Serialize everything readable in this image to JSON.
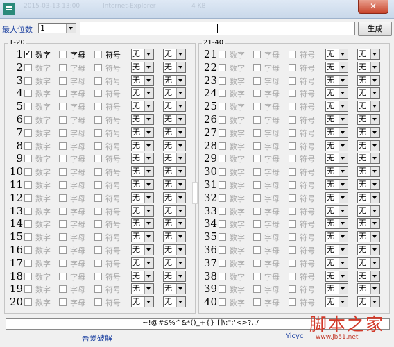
{
  "window": {
    "ghost_texts": [
      "2015-03-13 13:00",
      "Internet-Explorer",
      "4 KB"
    ],
    "close_label": "✕"
  },
  "toolbar": {
    "max_digits_label": "最大位数",
    "max_digits_value": "1",
    "output_value": "",
    "generate_label": "生成"
  },
  "left_group": {
    "title": "1-20",
    "rows": [
      {
        "n": "1",
        "digit": "数字",
        "letter": "字母",
        "symbol": "符号",
        "opt1": "无",
        "opt2": "无"
      },
      {
        "n": "2",
        "digit": "数字",
        "letter": "字母",
        "symbol": "符号",
        "opt1": "无",
        "opt2": "无"
      },
      {
        "n": "3",
        "digit": "数字",
        "letter": "字母",
        "symbol": "符号",
        "opt1": "无",
        "opt2": "无"
      },
      {
        "n": "4",
        "digit": "数字",
        "letter": "字母",
        "symbol": "符号",
        "opt1": "无",
        "opt2": "无"
      },
      {
        "n": "5",
        "digit": "数字",
        "letter": "字母",
        "symbol": "符号",
        "opt1": "无",
        "opt2": "无"
      },
      {
        "n": "6",
        "digit": "数字",
        "letter": "字母",
        "symbol": "符号",
        "opt1": "无",
        "opt2": "无"
      },
      {
        "n": "7",
        "digit": "数字",
        "letter": "字母",
        "symbol": "符号",
        "opt1": "无",
        "opt2": "无"
      },
      {
        "n": "8",
        "digit": "数字",
        "letter": "字母",
        "symbol": "符号",
        "opt1": "无",
        "opt2": "无"
      },
      {
        "n": "9",
        "digit": "数字",
        "letter": "字母",
        "symbol": "符号",
        "opt1": "无",
        "opt2": "无"
      },
      {
        "n": "10",
        "digit": "数字",
        "letter": "字母",
        "symbol": "符号",
        "opt1": "无",
        "opt2": "无"
      },
      {
        "n": "11",
        "digit": "数字",
        "letter": "字母",
        "symbol": "符号",
        "opt1": "无",
        "opt2": "无"
      },
      {
        "n": "12",
        "digit": "数字",
        "letter": "字母",
        "symbol": "符号",
        "opt1": "无",
        "opt2": "无"
      },
      {
        "n": "13",
        "digit": "数字",
        "letter": "字母",
        "symbol": "符号",
        "opt1": "无",
        "opt2": "无"
      },
      {
        "n": "14",
        "digit": "数字",
        "letter": "字母",
        "symbol": "符号",
        "opt1": "无",
        "opt2": "无"
      },
      {
        "n": "15",
        "digit": "数字",
        "letter": "字母",
        "symbol": "符号",
        "opt1": "无",
        "opt2": "无"
      },
      {
        "n": "16",
        "digit": "数字",
        "letter": "字母",
        "symbol": "符号",
        "opt1": "无",
        "opt2": "无"
      },
      {
        "n": "17",
        "digit": "数字",
        "letter": "字母",
        "symbol": "符号",
        "opt1": "无",
        "opt2": "无"
      },
      {
        "n": "18",
        "digit": "数字",
        "letter": "字母",
        "symbol": "符号",
        "opt1": "无",
        "opt2": "无"
      },
      {
        "n": "19",
        "digit": "数字",
        "letter": "字母",
        "symbol": "符号",
        "opt1": "无",
        "opt2": "无"
      },
      {
        "n": "20",
        "digit": "数字",
        "letter": "字母",
        "symbol": "符号",
        "opt1": "无",
        "opt2": "无"
      }
    ],
    "enabled_rows": 1
  },
  "right_group": {
    "title": "21-40",
    "rows": [
      {
        "n": "21",
        "digit": "数字",
        "letter": "字母",
        "symbol": "符号",
        "opt1": "无",
        "opt2": "无"
      },
      {
        "n": "22",
        "digit": "数字",
        "letter": "字母",
        "symbol": "符号",
        "opt1": "无",
        "opt2": "无"
      },
      {
        "n": "23",
        "digit": "数字",
        "letter": "字母",
        "symbol": "符号",
        "opt1": "无",
        "opt2": "无"
      },
      {
        "n": "24",
        "digit": "数字",
        "letter": "字母",
        "symbol": "符号",
        "opt1": "无",
        "opt2": "无"
      },
      {
        "n": "25",
        "digit": "数字",
        "letter": "字母",
        "symbol": "符号",
        "opt1": "无",
        "opt2": "无"
      },
      {
        "n": "26",
        "digit": "数字",
        "letter": "字母",
        "symbol": "符号",
        "opt1": "无",
        "opt2": "无"
      },
      {
        "n": "27",
        "digit": "数字",
        "letter": "字母",
        "symbol": "符号",
        "opt1": "无",
        "opt2": "无"
      },
      {
        "n": "28",
        "digit": "数字",
        "letter": "字母",
        "symbol": "符号",
        "opt1": "无",
        "opt2": "无"
      },
      {
        "n": "29",
        "digit": "数字",
        "letter": "字母",
        "symbol": "符号",
        "opt1": "无",
        "opt2": "无"
      },
      {
        "n": "30",
        "digit": "数字",
        "letter": "字母",
        "symbol": "符号",
        "opt1": "无",
        "opt2": "无"
      },
      {
        "n": "31",
        "digit": "数字",
        "letter": "字母",
        "symbol": "符号",
        "opt1": "无",
        "opt2": "无"
      },
      {
        "n": "32",
        "digit": "数字",
        "letter": "字母",
        "symbol": "符号",
        "opt1": "无",
        "opt2": "无"
      },
      {
        "n": "33",
        "digit": "数字",
        "letter": "字母",
        "symbol": "符号",
        "opt1": "无",
        "opt2": "无"
      },
      {
        "n": "34",
        "digit": "数字",
        "letter": "字母",
        "symbol": "符号",
        "opt1": "无",
        "opt2": "无"
      },
      {
        "n": "35",
        "digit": "数字",
        "letter": "字母",
        "symbol": "符号",
        "opt1": "无",
        "opt2": "无"
      },
      {
        "n": "36",
        "digit": "数字",
        "letter": "字母",
        "symbol": "符号",
        "opt1": "无",
        "opt2": "无"
      },
      {
        "n": "37",
        "digit": "数字",
        "letter": "字母",
        "symbol": "符号",
        "opt1": "无",
        "opt2": "无"
      },
      {
        "n": "38",
        "digit": "数字",
        "letter": "字母",
        "symbol": "符号",
        "opt1": "无",
        "opt2": "无"
      },
      {
        "n": "39",
        "digit": "数字",
        "letter": "字母",
        "symbol": "符号",
        "opt1": "无",
        "opt2": "无"
      },
      {
        "n": "40",
        "digit": "数字",
        "letter": "字母",
        "symbol": "符号",
        "opt1": "无",
        "opt2": "无"
      }
    ],
    "enabled_rows": 0
  },
  "checked": {
    "row1_digit": true
  },
  "charset_value": "~!@#$%^&*()_+{}|[]\\:\";'<>?,./",
  "status": {
    "credit": "吾爱破解",
    "author": "Yicyc"
  },
  "watermark": {
    "text": "脚本之家",
    "url": "www.jb51.net"
  },
  "colors": {
    "accent": "#1a3fa0",
    "disabled_text": "#a8a8a8",
    "watermark": "#d23a2a"
  }
}
